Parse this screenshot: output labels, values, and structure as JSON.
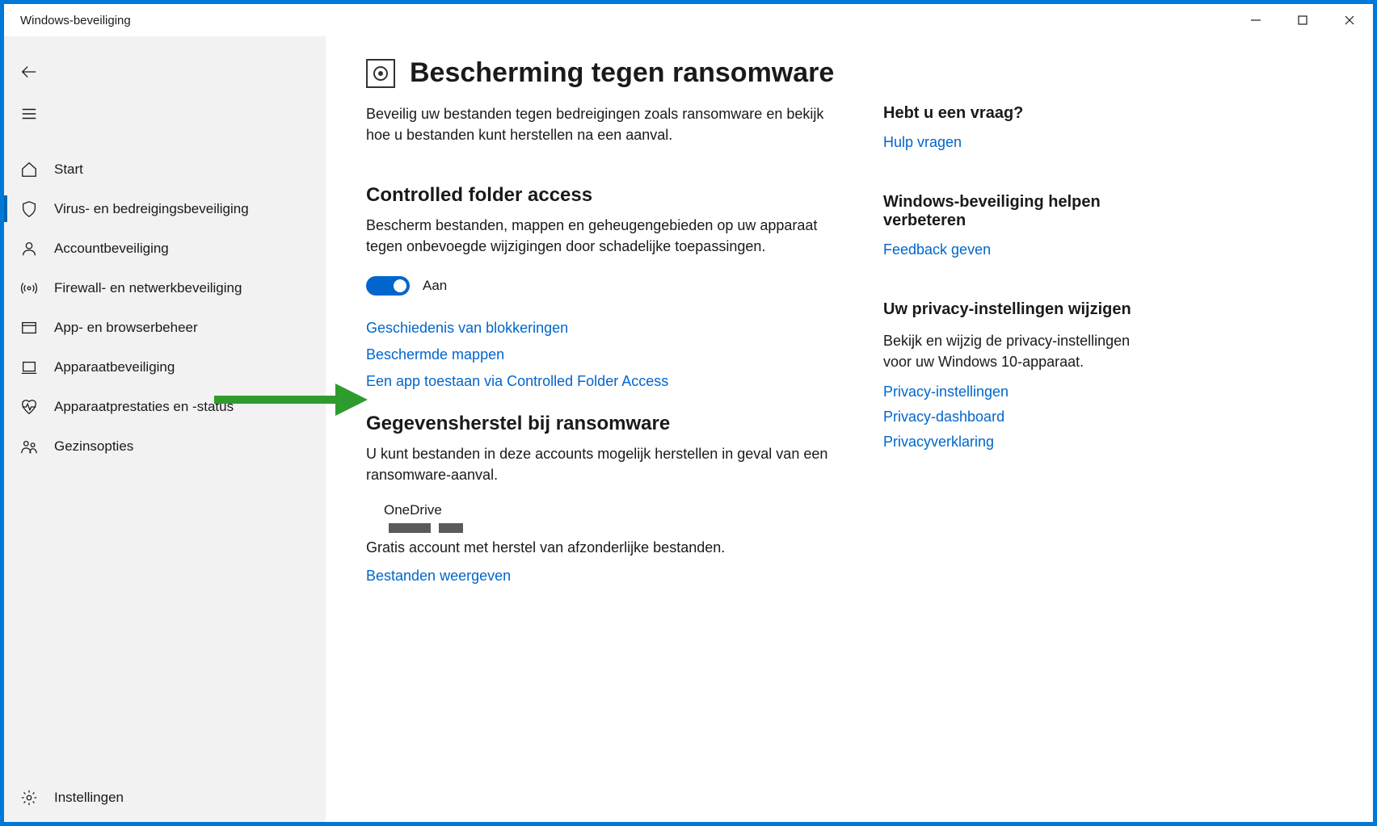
{
  "titlebar": {
    "title": "Windows-beveiliging"
  },
  "sidebar": {
    "items": [
      {
        "label": "Start"
      },
      {
        "label": "Virus- en bedreigingsbeveiliging"
      },
      {
        "label": "Accountbeveiliging"
      },
      {
        "label": "Firewall- en netwerkbeveiliging"
      },
      {
        "label": "App- en browserbeheer"
      },
      {
        "label": "Apparaatbeveiliging"
      },
      {
        "label": "Apparaatprestaties en -status"
      },
      {
        "label": "Gezinsopties"
      }
    ],
    "settings": "Instellingen"
  },
  "main": {
    "title": "Bescherming tegen ransomware",
    "lead": "Beveilig uw bestanden tegen bedreigingen zoals ransomware en bekijk hoe u bestanden kunt herstellen na een aanval.",
    "cfa": {
      "heading": "Controlled folder access",
      "desc": "Bescherm bestanden, mappen en geheugengebieden op uw apparaat tegen onbevoegde wijzigingen door schadelijke toepassingen.",
      "toggle_label": "Aan",
      "links": {
        "history": "Geschiedenis van blokkeringen",
        "protected": "Beschermde mappen",
        "allow": "Een app toestaan via Controlled Folder Access"
      }
    },
    "recovery": {
      "heading": "Gegevensherstel bij ransomware",
      "desc": "U kunt bestanden in deze accounts mogelijk herstellen in geval van een ransomware-aanval.",
      "onedrive_title": "OneDrive",
      "onedrive_desc": "Gratis account met herstel van afzonderlijke bestanden.",
      "onedrive_link": "Bestanden weergeven"
    }
  },
  "aside": {
    "question": {
      "heading": "Hebt u een vraag?",
      "link": "Hulp vragen"
    },
    "improve": {
      "heading": "Windows-beveiliging helpen verbeteren",
      "link": "Feedback geven"
    },
    "privacy": {
      "heading": "Uw privacy-instellingen wijzigen",
      "desc": "Bekijk en wijzig de privacy-instellingen voor uw Windows 10-apparaat.",
      "links": {
        "settings": "Privacy-instellingen",
        "dashboard": "Privacy-dashboard",
        "statement": "Privacyverklaring"
      }
    }
  }
}
